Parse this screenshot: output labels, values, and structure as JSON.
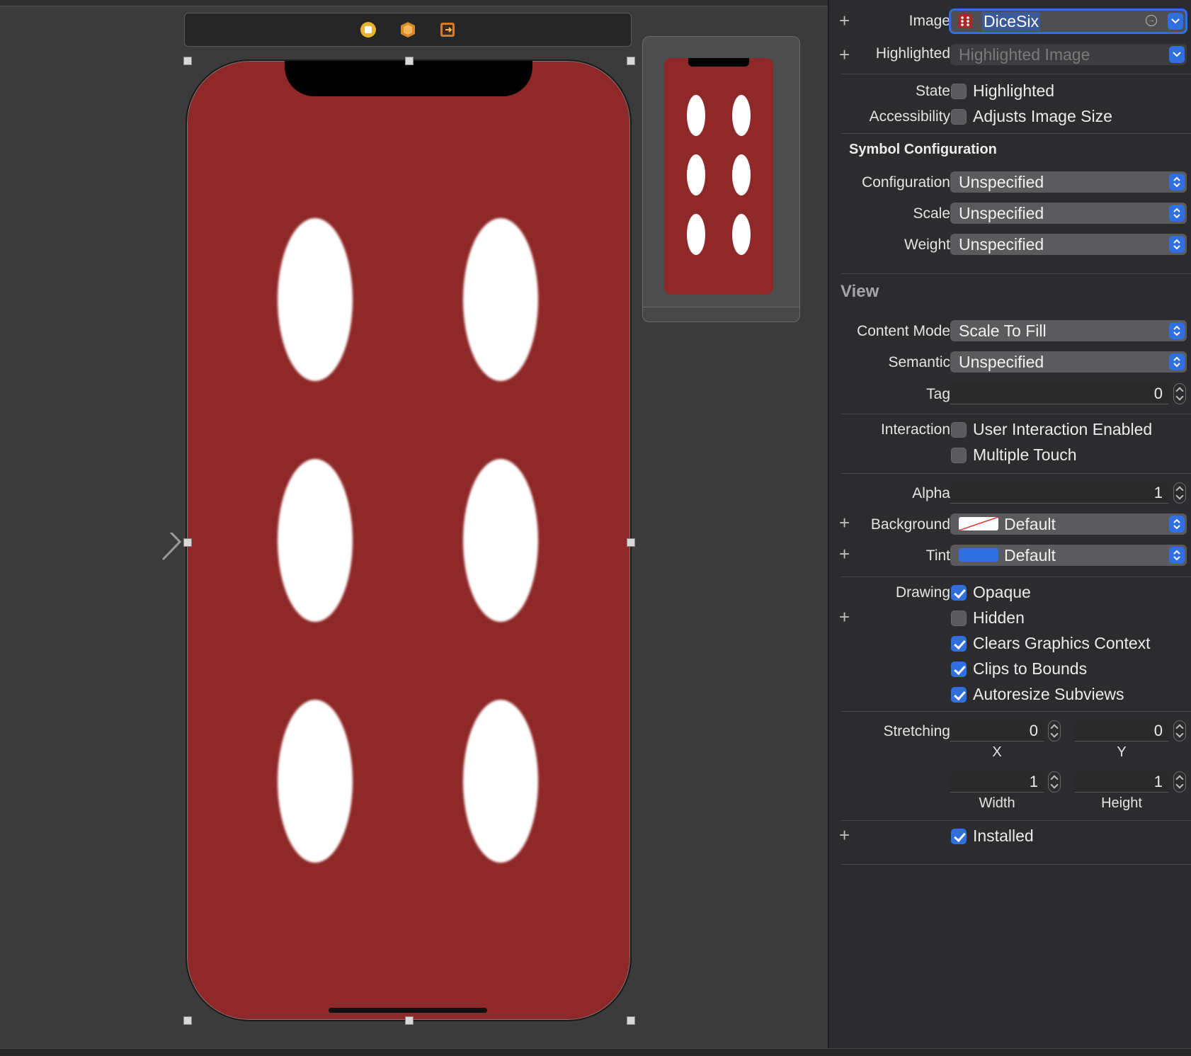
{
  "canvas": {
    "scene_bar_icons": [
      "view-controller-icon",
      "first-responder-icon",
      "exit-icon"
    ],
    "dice_color": "#8f2828",
    "pips": 6
  },
  "inspector": {
    "image": {
      "label": "Image",
      "value": "DiceSix"
    },
    "highlighted": {
      "label": "Highlighted",
      "placeholder": "Highlighted Image"
    },
    "state": {
      "label": "State",
      "checkbox": "Highlighted"
    },
    "accessibility": {
      "label": "Accessibility",
      "checkbox": "Adjusts Image Size"
    },
    "symbol_section": "Symbol Configuration",
    "configuration": {
      "label": "Configuration",
      "value": "Unspecified"
    },
    "scale": {
      "label": "Scale",
      "value": "Unspecified"
    },
    "weight": {
      "label": "Weight",
      "value": "Unspecified"
    },
    "view_section": "View",
    "content_mode": {
      "label": "Content Mode",
      "value": "Scale To Fill"
    },
    "semantic": {
      "label": "Semantic",
      "value": "Unspecified"
    },
    "tag": {
      "label": "Tag",
      "value": "0"
    },
    "interaction": {
      "label": "Interaction",
      "user_interaction": "User Interaction Enabled",
      "multiple_touch": "Multiple Touch"
    },
    "alpha": {
      "label": "Alpha",
      "value": "1"
    },
    "background": {
      "label": "Background",
      "value": "Default"
    },
    "tint": {
      "label": "Tint",
      "value": "Default",
      "color": "#2f6fe0"
    },
    "drawing": {
      "label": "Drawing",
      "opaque": "Opaque",
      "hidden": "Hidden",
      "clears": "Clears Graphics Context",
      "clips": "Clips to Bounds",
      "autoresize": "Autoresize Subviews"
    },
    "stretching": {
      "label": "Stretching",
      "x": "0",
      "y": "0",
      "width": "1",
      "height": "1",
      "x_label": "X",
      "y_label": "Y",
      "width_label": "Width",
      "height_label": "Height"
    },
    "installed": "Installed"
  }
}
